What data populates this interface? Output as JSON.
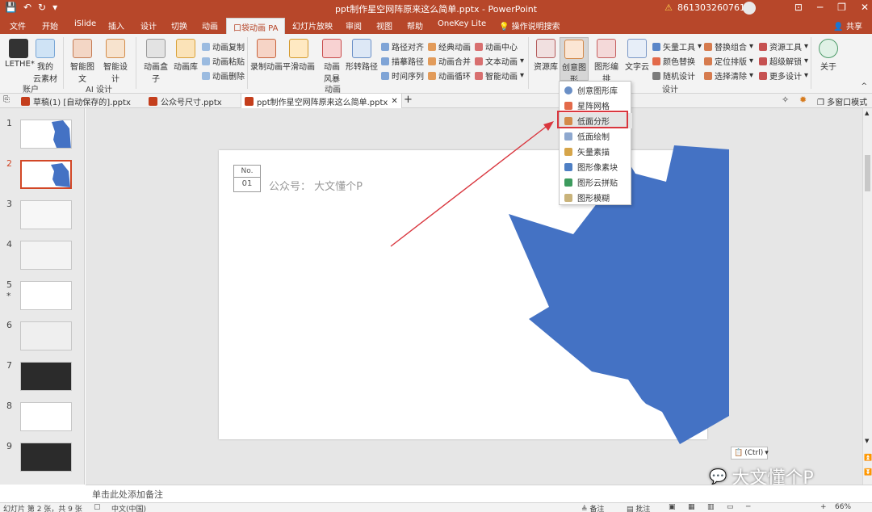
{
  "titlebar": {
    "title": "ppt制作星空网阵原来这么简单.pptx  -  PowerPoint",
    "account": "8613032607617",
    "warn_icon": "warning-icon"
  },
  "tabs": [
    "文件",
    "开始",
    "iSlide",
    "插入",
    "设计",
    "切换",
    "动画",
    "口袋动画 PA",
    "幻灯片放映",
    "审阅",
    "视图",
    "帮助",
    "OneKey Lite"
  ],
  "tab_active_index": 7,
  "help_label": "操作说明搜索",
  "share_label": "共享",
  "ribbon": {
    "lethe": "LETHE*",
    "cloud": "我的\n云素材",
    "account_group": "账户",
    "ai1": "智能图文",
    "ai2": "智能设计",
    "ai_group": "AI 设计",
    "anim_box": "动画盒子",
    "anim_lib": "动画库",
    "copy_anim": "动画复制",
    "paste_anim": "动画粘贴",
    "del_anim": "动画删除",
    "record_anim": "录制动画",
    "smooth_anim": "平滑动画",
    "anim_style": "动画\n风暴",
    "shape_path": "形转路径",
    "path_align": "路径对齐",
    "trace_path": "描摹路径",
    "time_seq": "时间序列",
    "classic_anim": "经典动画",
    "anim_merge": "动画合并",
    "anim_loop": "动画循环",
    "anim_center": "动画中心",
    "text_anim": "文本动画",
    "smart_anim": "智能动画",
    "anim_group": "动画",
    "resource": "资源库",
    "creative": "创意图形",
    "shape_edit": "图形编排",
    "word_cloud": "文字云",
    "vector_tool": "矢量工具",
    "color_replace": "颜色替换",
    "random_design": "随机设计",
    "replace_combo": "替换组合",
    "position_layout": "定位排版",
    "select_clear": "选择清除",
    "resource_tool": "资源工具",
    "super_unlock": "超级解锁",
    "more_design": "更多设计",
    "design_group": "设计",
    "about": "关于"
  },
  "doc_tabs": [
    "草稿(1) [自动保存的].pptx",
    "公众号尺寸.pptx",
    "ppt制作星空网阵原来这么简单.pptx"
  ],
  "multi_window": "多窗口模式",
  "thumbnails": [
    "1",
    "2",
    "3",
    "4",
    "5",
    "6",
    "7",
    "8",
    "9"
  ],
  "slide5_star": "*",
  "slide": {
    "no_label": "No.",
    "no_value": "01",
    "caption": "公众号：  大文懂个P",
    "shape_color": "#4472c4"
  },
  "dropdown": [
    "创意图形库",
    "星阵网格",
    "低面分形",
    "低面绘制",
    "矢量素描",
    "图形像素块",
    "图形云拼贴",
    "图形模糊"
  ],
  "dropdown_highlight_index": 2,
  "notes_placeholder": "单击此处添加备注",
  "ctrl_label": "(Ctrl)",
  "watermark": "大文懂个P",
  "status": {
    "slide_info": "幻灯片 第 2 张，共 9 张",
    "language": "中文(中国)",
    "notes": "备注",
    "comments": "批注",
    "zoom": "66%"
  },
  "colors": {
    "accent": "#b7472a",
    "highlight_box": "#d9363e",
    "arrow": "#d9363e"
  }
}
